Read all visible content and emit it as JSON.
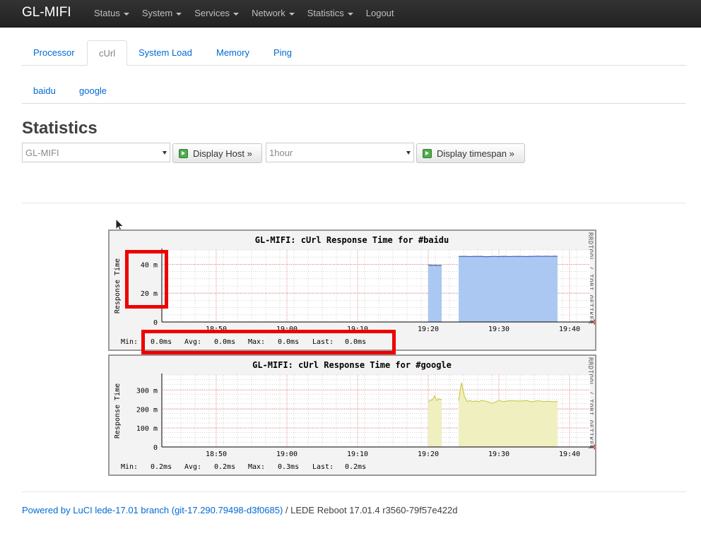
{
  "nav": {
    "brand": "GL-MIFI",
    "items": [
      {
        "label": "Status",
        "has_caret": true
      },
      {
        "label": "System",
        "has_caret": true
      },
      {
        "label": "Services",
        "has_caret": true
      },
      {
        "label": "Network",
        "has_caret": true
      },
      {
        "label": "Statistics",
        "has_caret": true
      },
      {
        "label": "Logout",
        "has_caret": false
      }
    ]
  },
  "tabs": [
    {
      "label": "Processor",
      "active": false
    },
    {
      "label": "cUrl",
      "active": true
    },
    {
      "label": "System Load",
      "active": false
    },
    {
      "label": "Memory",
      "active": false
    },
    {
      "label": "Ping",
      "active": false
    }
  ],
  "subtabs": [
    {
      "label": "baidu"
    },
    {
      "label": "google"
    }
  ],
  "page_title": "Statistics",
  "controls": {
    "host_select": "GL-MIFI",
    "host_button": "Display Host »",
    "timespan_select": "1hour",
    "timespan_button": "Display timespan »"
  },
  "chart_data": [
    {
      "type": "area",
      "title": "GL-MIFI: cUrl Response Time for #baidu",
      "ylabel": "Response Time",
      "side_label": "RRDTOOL / TOBI OETIKER",
      "yticks": [
        "0",
        "20 m",
        "40 m"
      ],
      "ylim": [
        0,
        0.05
      ],
      "xticks": [
        "18:50",
        "19:00",
        "19:10",
        "19:20",
        "19:30",
        "19:40"
      ],
      "color": "#aac8f2",
      "line_color": "#1f4fa0",
      "series": [
        {
          "x": [
            19.25,
            19.27,
            19.3,
            19.35,
            19.4,
            19.45,
            19.5,
            19.52,
            19.55,
            19.6,
            19.65,
            19.7,
            19.75,
            19.8,
            19.85,
            19.88,
            19.9,
            19.95,
            20.0,
            20.05,
            20.1,
            20.15,
            20.2
          ],
          "y": [
            0.0398,
            0.0397,
            0.0395,
            0.0393,
            0.0394,
            0.0393,
            0.0394,
            0.0395,
            0.0393,
            0.0392,
            0.0393,
            0.0394,
            0.0394,
            0.0393,
            0.0393,
            0.0392,
            0.0393,
            0.0393,
            0.0392,
            0.0393,
            0.0392,
            0.0393,
            0.0393
          ],
          "segment": 1
        },
        {
          "x": [
            21.4,
            21.6,
            21.8,
            22.0,
            22.2,
            22.4,
            22.6,
            22.8,
            23.0,
            23.2,
            23.4,
            23.6,
            23.8,
            24.0,
            24.2,
            24.4,
            24.6,
            24.8,
            25.0,
            25.2,
            25.4,
            25.6,
            25.8,
            26.0,
            26.2,
            26.4,
            26.6,
            26.8,
            27.0,
            27.2,
            27.4,
            27.6,
            27.8,
            28.0,
            28.2,
            28.4
          ],
          "y": [
            0.0455,
            0.0455,
            0.0456,
            0.0455,
            0.0454,
            0.0455,
            0.0456,
            0.0455,
            0.0456,
            0.0454,
            0.0453,
            0.0454,
            0.0455,
            0.0455,
            0.0454,
            0.0455,
            0.0456,
            0.0455,
            0.0454,
            0.0455,
            0.0455,
            0.0456,
            0.0455,
            0.0455,
            0.0454,
            0.0456,
            0.0455,
            0.0456,
            0.0457,
            0.0456,
            0.0456,
            0.0457,
            0.0456,
            0.0456,
            0.0457,
            0.0456
          ],
          "segment": 2
        }
      ],
      "stats": [
        {
          "label": "Min:",
          "value": "0.0ms"
        },
        {
          "label": "Avg:",
          "value": "0.0ms"
        },
        {
          "label": "Max:",
          "value": "0.0ms"
        },
        {
          "label": "Last:",
          "value": "0.0ms"
        }
      ]
    },
    {
      "type": "area",
      "title": "GL-MIFI: cUrl Response Time for #google",
      "ylabel": "Response Time",
      "side_label": "RRDTOOL / TOBI OETIKER",
      "yticks": [
        "0",
        "100 m",
        "200 m",
        "300 m"
      ],
      "ylim": [
        0,
        0.38
      ],
      "xticks": [
        "18:50",
        "19:00",
        "19:10",
        "19:20",
        "19:30",
        "19:40"
      ],
      "color": "#f0efbf",
      "line_color": "#c8c23a",
      "series": [
        {
          "x": [
            19.25,
            19.4,
            19.55,
            19.7,
            19.85,
            20.0,
            20.15,
            20.2
          ],
          "y": [
            0.236,
            0.247,
            0.249,
            0.27,
            0.245,
            0.255,
            0.25,
            0.252
          ],
          "segment": 1
        },
        {
          "x": [
            21.4,
            21.6,
            21.8,
            22.0,
            22.2,
            22.4,
            22.6,
            22.8,
            23.0,
            23.4,
            23.8,
            24.2,
            24.6,
            25.0,
            25.4,
            25.8,
            26.2,
            26.6,
            27.0,
            27.4,
            27.8,
            28.2,
            28.4
          ],
          "y": [
            0.244,
            0.34,
            0.27,
            0.24,
            0.245,
            0.24,
            0.243,
            0.238,
            0.245,
            0.241,
            0.23,
            0.245,
            0.24,
            0.244,
            0.243,
            0.242,
            0.245,
            0.238,
            0.244,
            0.24,
            0.241,
            0.238,
            0.242
          ],
          "segment": 2
        }
      ],
      "stats": [
        {
          "label": "Min:",
          "value": "0.2ms"
        },
        {
          "label": "Avg:",
          "value": "0.2ms"
        },
        {
          "label": "Max:",
          "value": "0.3ms"
        },
        {
          "label": "Last:",
          "value": "0.2ms"
        }
      ]
    }
  ],
  "footer": {
    "link": "Powered by LuCI lede-17.01 branch (git-17.290.79498-d3f0685)",
    "text": " / LEDE Reboot 17.01.4 r3560-79f57e422d"
  }
}
